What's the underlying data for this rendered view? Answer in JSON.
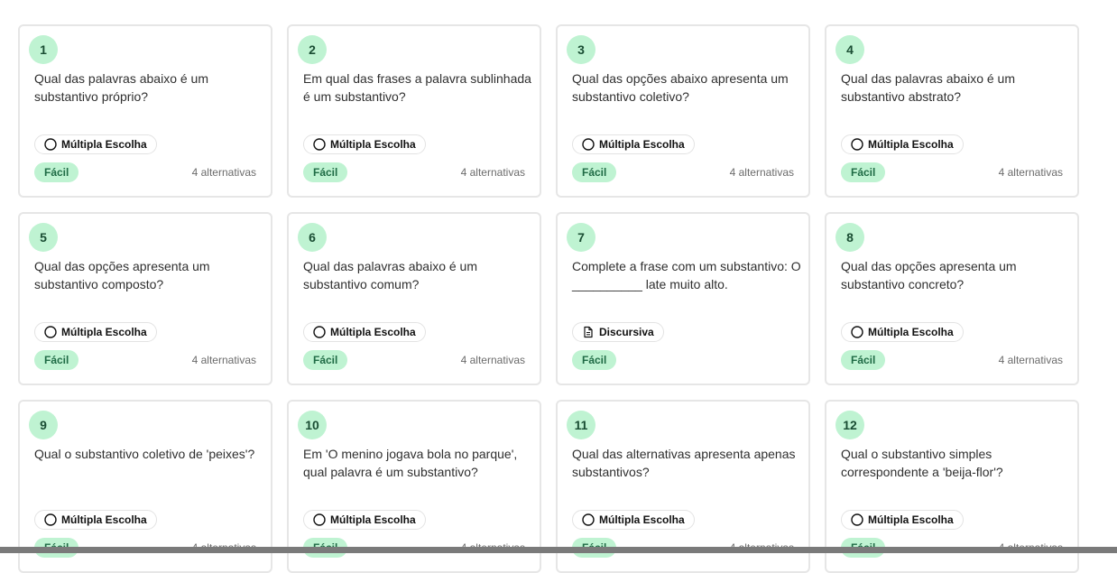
{
  "questions": [
    {
      "number": "1",
      "text": "Qual das palavras abaixo é um substantivo próprio?",
      "type": "Múltipla Escolha",
      "type_icon": "radio-circle-icon",
      "difficulty": "Fácil",
      "alternatives": "4 alternativas"
    },
    {
      "number": "2",
      "text": "Em qual das frases a palavra sublinhada é um substantivo?",
      "type": "Múltipla Escolha",
      "type_icon": "radio-circle-icon",
      "difficulty": "Fácil",
      "alternatives": "4 alternativas"
    },
    {
      "number": "3",
      "text": "Qual das opções abaixo apresenta um substantivo coletivo?",
      "type": "Múltipla Escolha",
      "type_icon": "radio-circle-icon",
      "difficulty": "Fácil",
      "alternatives": "4 alternativas"
    },
    {
      "number": "4",
      "text": "Qual das palavras abaixo é um substantivo abstrato?",
      "type": "Múltipla Escolha",
      "type_icon": "radio-circle-icon",
      "difficulty": "Fácil",
      "alternatives": "4 alternativas"
    },
    {
      "number": "5",
      "text": "Qual das opções apresenta um substantivo composto?",
      "type": "Múltipla Escolha",
      "type_icon": "radio-circle-icon",
      "difficulty": "Fácil",
      "alternatives": "4 alternativas"
    },
    {
      "number": "6",
      "text": "Qual das palavras abaixo é um substantivo comum?",
      "type": "Múltipla Escolha",
      "type_icon": "radio-circle-icon",
      "difficulty": "Fácil",
      "alternatives": "4 alternativas"
    },
    {
      "number": "7",
      "text": "Complete a frase com um substantivo: O __________ late muito alto.",
      "type": "Discursiva",
      "type_icon": "document-icon",
      "difficulty": "Fácil",
      "alternatives": ""
    },
    {
      "number": "8",
      "text": "Qual das opções apresenta um substantivo concreto?",
      "type": "Múltipla Escolha",
      "type_icon": "radio-circle-icon",
      "difficulty": "Fácil",
      "alternatives": "4 alternativas"
    },
    {
      "number": "9",
      "text": "Qual o substantivo coletivo de 'peixes'?",
      "type": "Múltipla Escolha",
      "type_icon": "radio-circle-icon",
      "difficulty": "Fácil",
      "alternatives": "4 alternativas"
    },
    {
      "number": "10",
      "text": "Em 'O menino jogava bola no parque', qual palavra é um substantivo?",
      "type": "Múltipla Escolha",
      "type_icon": "radio-circle-icon",
      "difficulty": "Fácil",
      "alternatives": "4 alternativas"
    },
    {
      "number": "11",
      "text": "Qual das alternativas apresenta apenas substantivos?",
      "type": "Múltipla Escolha",
      "type_icon": "radio-circle-icon",
      "difficulty": "Fácil",
      "alternatives": "4 alternativas"
    },
    {
      "number": "12",
      "text": "Qual o substantivo simples correspondente a 'beija-flor'?",
      "type": "Múltipla Escolha",
      "type_icon": "radio-circle-icon",
      "difficulty": "Fácil",
      "alternatives": "4 alternativas"
    }
  ],
  "colors": {
    "accent_green_bg": "#bff3d2",
    "accent_green_text": "#1f6b45",
    "card_border": "#e6e6e6"
  }
}
